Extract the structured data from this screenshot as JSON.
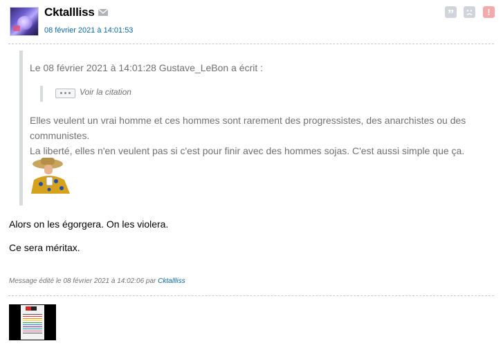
{
  "post": {
    "author": "Cktallliss",
    "date": "08 février 2021 à 14:01:53",
    "quote": {
      "header": "Le 08 février 2021 à 14:01:28 Gustave_LeBon a écrit :",
      "toggle_label": "Voir la citation",
      "lines": [
        "Elles veulent un vrai homme et ces hommes sont rarement des progressistes, des anarchistes ou des",
        "communistes.",
        "La liberté, elles n'en veulent pas si c'est pour finir avec des hommes sojas. C'est aussi simple que ça."
      ]
    },
    "body": [
      "Alors on les égorgera. On les violera.",
      "Ce sera méritax."
    ],
    "edit_note": {
      "prefix": "Message édité le 08 février 2021 à 14:02:06 par ",
      "by": "Cktallliss"
    },
    "actions": {
      "quote_symbol": "”",
      "alert_symbol": "!"
    }
  },
  "icons": {
    "mail": "mail-icon",
    "quote": "quote-icon",
    "sad": "sad-face-icon",
    "alert": "alert-icon"
  },
  "colors": {
    "link": "#0b67a6",
    "quote_text": "#717171",
    "alert_button": "#f2aaaa",
    "action_button": "#d1d5db"
  }
}
